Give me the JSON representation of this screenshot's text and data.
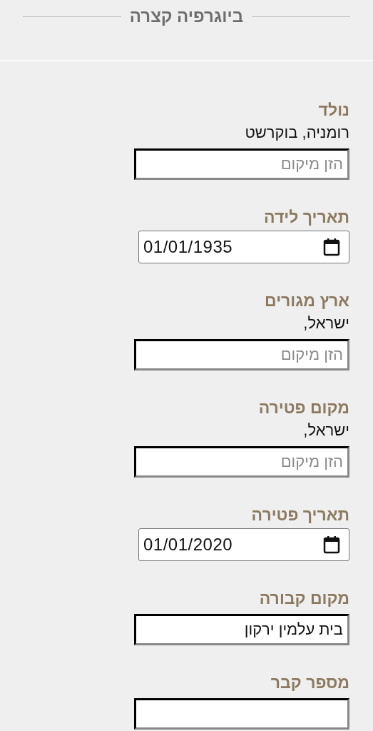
{
  "section_title": "ביוגרפיה קצרה",
  "fields": [
    {
      "kind": "location",
      "label": "נולד",
      "value": "רומניה, בוקרשט",
      "placeholder": "הזן מיקום"
    },
    {
      "kind": "date",
      "label": "תאריך לידה",
      "value": "01/01/1935"
    },
    {
      "kind": "location",
      "label": "ארץ מגורים",
      "value": "ישראל,",
      "placeholder": "הזן מיקום"
    },
    {
      "kind": "location",
      "label": "מקום פטירה",
      "value": "ישראל,",
      "placeholder": "הזן מיקום"
    },
    {
      "kind": "date",
      "label": "תאריך פטירה",
      "value": "01/01/2020"
    },
    {
      "kind": "text",
      "label": "מקום קבורה",
      "value": "בית עלמין ירקון"
    },
    {
      "kind": "text",
      "label": "מספר קבר"
    }
  ]
}
